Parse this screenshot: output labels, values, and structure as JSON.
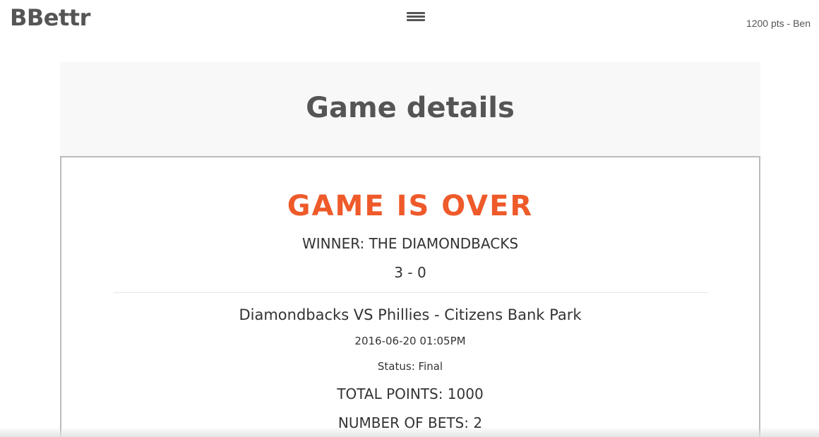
{
  "header": {
    "logo": "BBettr",
    "user_info": "1200 pts - Ben"
  },
  "hero": {
    "title": "Game details"
  },
  "game": {
    "status_banner": "GAME IS OVER",
    "winner": "WINNER: THE DIAMONDBACKS",
    "score": "3 - 0",
    "matchup": "Diamondbacks VS Phillies - Citizens Bank Park",
    "datetime": "2016-06-20 01:05PM",
    "status": "Status: Final",
    "total_points": "TOTAL POINTS: 1000",
    "number_of_bets": "NUMBER OF BETS: 2"
  },
  "colors": {
    "accent": "#ee5a2a",
    "text": "#333333",
    "logo": "#555555",
    "hero_bg": "#f8f8f8",
    "card_border": "#bbbbbb"
  },
  "icons": {
    "menu": "hamburger-menu-icon"
  }
}
